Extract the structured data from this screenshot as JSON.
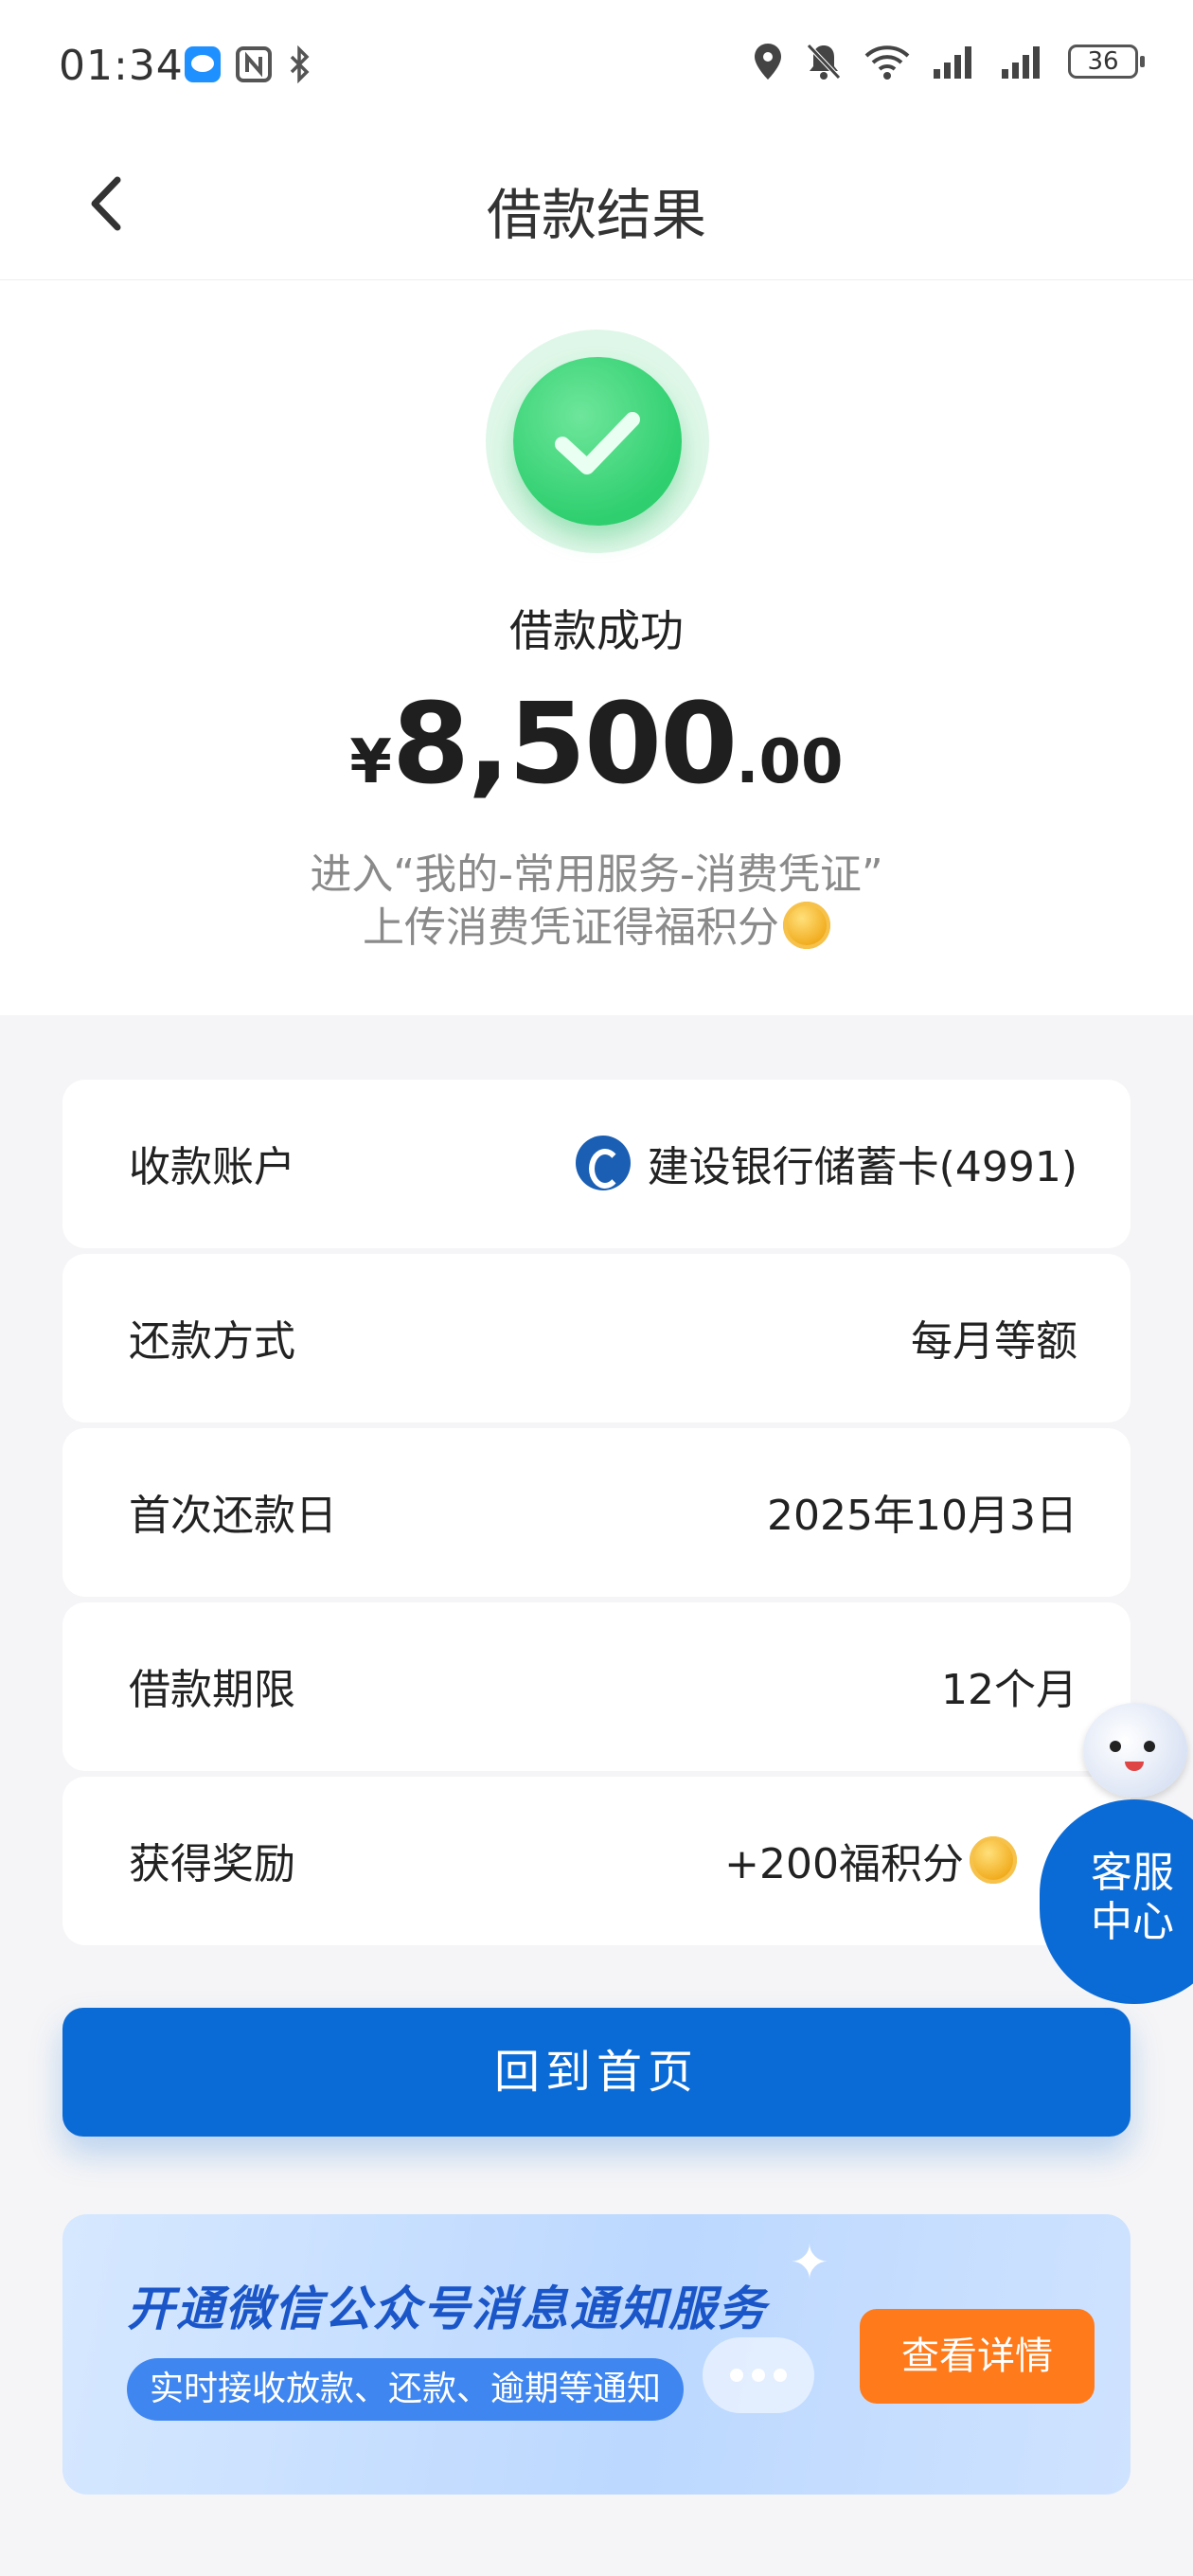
{
  "status_bar": {
    "time": "01:34",
    "battery": "36"
  },
  "header": {
    "title": "借款结果"
  },
  "result": {
    "status": "借款成功",
    "currency_symbol": "¥",
    "amount_int": "8,500",
    "amount_dec": ".00",
    "tip_line1": "进入“我的-常用服务-消费凭证”",
    "tip_line2": "上传消费凭证得福积分"
  },
  "rows": [
    {
      "label": "收款账户",
      "value": "建设银行储蓄卡(4991)"
    },
    {
      "label": "还款方式",
      "value": "每月等额"
    },
    {
      "label": "首次还款日",
      "value": "2025年10月3日"
    },
    {
      "label": "借款期限",
      "value": "12个月"
    },
    {
      "label": "获得奖励",
      "value": "+200福积分"
    }
  ],
  "home_button": "回到首页",
  "banner": {
    "title": "开通微信公众号消息通知服务",
    "subtitle": "实时接收放款、还款、逾期等通知",
    "button": "查看详情"
  },
  "customer_service": {
    "line1": "客服",
    "line2": "中心"
  },
  "colors": {
    "primary": "#0b6bd6",
    "success": "#2fcf6f",
    "orange": "#ff7a1a"
  }
}
